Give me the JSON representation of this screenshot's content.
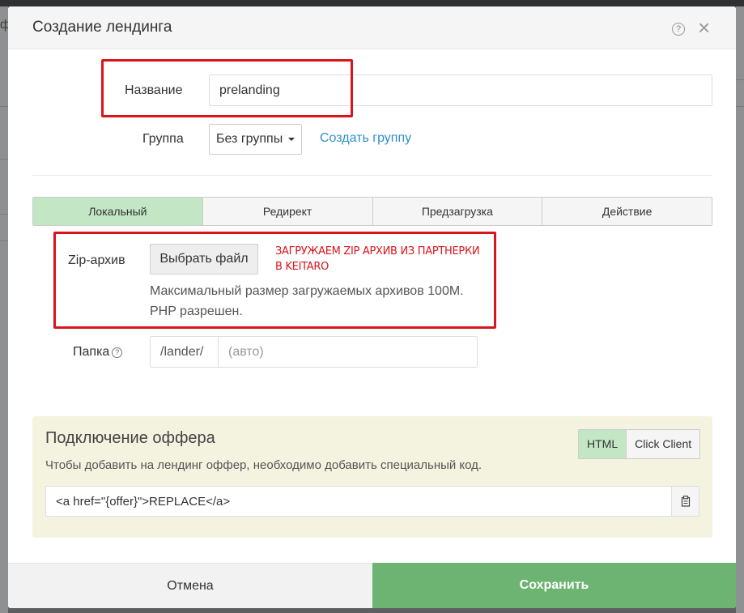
{
  "background": {
    "left_fragment": "ф"
  },
  "modal": {
    "title": "Создание лендинга",
    "help_symbol": "?",
    "close_symbol": "×"
  },
  "form": {
    "name_label": "Название",
    "name_value": "prelanding",
    "group_label": "Группа",
    "group_selected": "Без группы",
    "create_group_link": "Создать группу",
    "tabs": [
      {
        "label": "Локальный",
        "active": true
      },
      {
        "label": "Редирект",
        "active": false
      },
      {
        "label": "Предзагрузка",
        "active": false
      },
      {
        "label": "Действие",
        "active": false
      }
    ],
    "zip_label": "Zip-архив",
    "file_button": "Выбрать файл",
    "annotation": "Загружаем zip архив из партнерки в Keitaro",
    "help_line1": "Максимальный размер загружаемых архивов 100M.",
    "help_line2": "PHP разрешен.",
    "folder_label": "Папка",
    "folder_help_symbol": "?",
    "folder_prefix": "/lander/",
    "folder_placeholder": "(авто)"
  },
  "offer": {
    "title": "Подключение оффера",
    "description": "Чтобы добавить на лендинг оффер, необходимо добавить специальный код.",
    "toggle_html": "HTML",
    "toggle_click_client": "Click Client",
    "code_value": "<a href=\"{offer}\">REPLACE</a>"
  },
  "footer": {
    "cancel_label": "Отмена",
    "save_label": "Сохранить"
  },
  "colors": {
    "accent_green": "#6db472",
    "active_tab": "#c3e7c4",
    "link_blue": "#2f8fc9",
    "annotation_red": "#d9141b",
    "offer_panel_bg": "#f4f3e0"
  }
}
